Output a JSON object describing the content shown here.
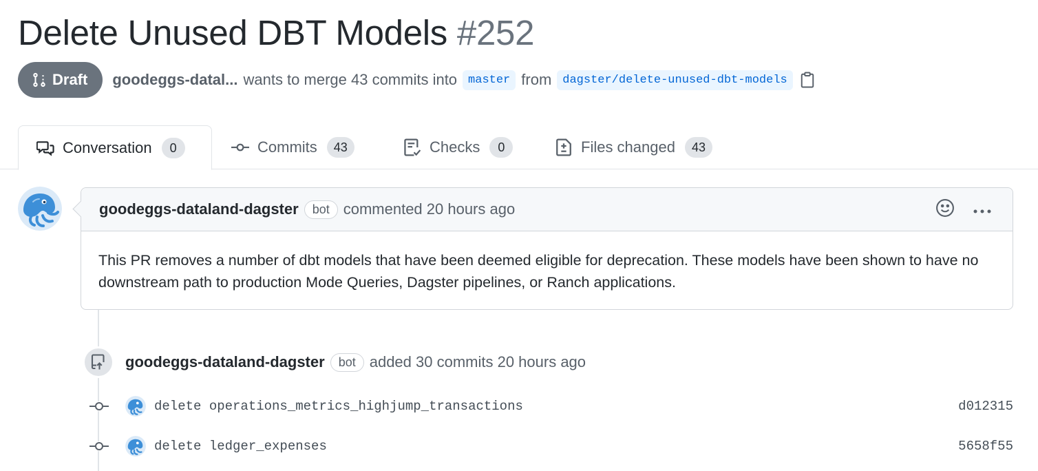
{
  "pr": {
    "title": "Delete Unused DBT Models",
    "number": "#252",
    "state": "Draft",
    "author": "goodeggs-datal...",
    "merge_text": "wants to merge 43 commits into",
    "base_branch": "master",
    "from_text": "from",
    "head_branch": "dagster/delete-unused-dbt-models"
  },
  "tabs": [
    {
      "label": "Conversation",
      "count": "0",
      "icon": "comment-discussion-icon"
    },
    {
      "label": "Commits",
      "count": "43",
      "icon": "git-commit-icon"
    },
    {
      "label": "Checks",
      "count": "0",
      "icon": "checklist-icon"
    },
    {
      "label": "Files changed",
      "count": "43",
      "icon": "file-diff-icon"
    }
  ],
  "comment": {
    "author": "goodeggs-dataland-dagster",
    "badge": "bot",
    "meta": "commented 20 hours ago",
    "body": "This PR removes a number of dbt models that have been deemed eligible for deprecation. These models have been shown to have no downstream path to production Mode Queries, Dagster pipelines, or Ranch applications."
  },
  "event": {
    "author": "goodeggs-dataland-dagster",
    "badge": "bot",
    "text": "added 30 commits 20 hours ago"
  },
  "commits": [
    {
      "message": "delete operations_metrics_highjump_transactions",
      "sha": "d012315"
    },
    {
      "message": "delete ledger_expenses",
      "sha": "5658f55"
    }
  ],
  "colors": {
    "draft": "#6a737d",
    "branch_bg": "#eaf5ff",
    "branch_fg": "#0366d6",
    "avatar": "#3d8fd8"
  }
}
